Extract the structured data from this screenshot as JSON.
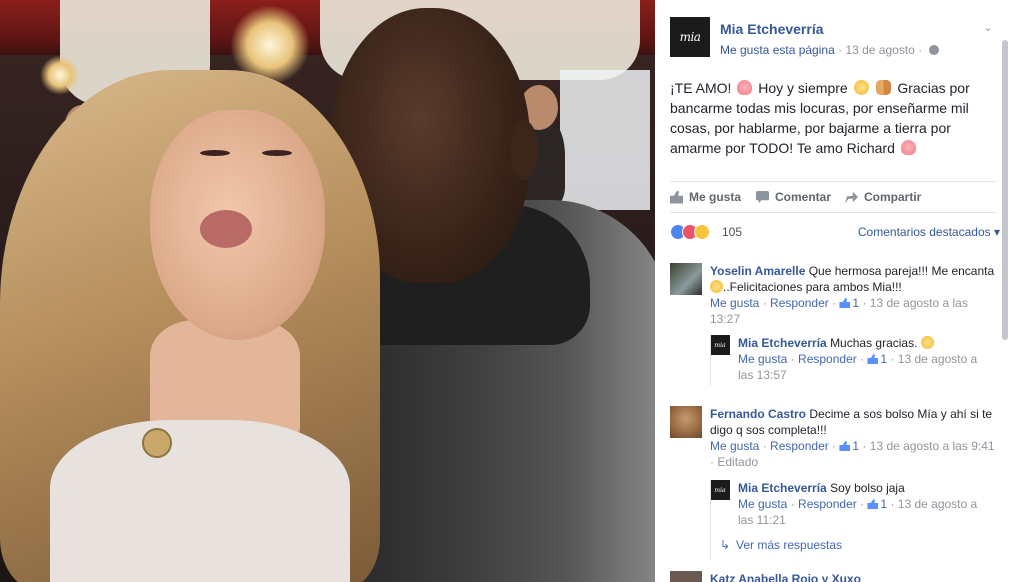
{
  "post": {
    "page_name": "Mia Etcheverría",
    "logo_text": "mia",
    "like_page": "Me gusta esta página",
    "date": "13 de agosto",
    "text_1": "¡TE AMO!",
    "text_2": "Hoy y siempre",
    "text_3": "Gracias por bancarme todas mis locuras, por enseñarme mil cosas, por hablarme, por bajarme a tierra por amarme por TODO! Te amo Richard",
    "icons": [
      "heart-emoji",
      "heart-eyes-emoji",
      "couple-emoji",
      "globe-icon",
      "chevron-down-icon"
    ]
  },
  "actions": {
    "like": "Me gusta",
    "comment": "Comentar",
    "share": "Compartir"
  },
  "reactions": {
    "count": "105",
    "sort_label": "Comentarios destacados",
    "types": [
      "like",
      "love",
      "wow"
    ],
    "colors": {
      "like": "#4e86f0",
      "love": "#f0506e",
      "wow": "#f7c53a"
    }
  },
  "comments": [
    {
      "name": "Yoselin Amarelle",
      "text_a": "Que hermosa pareja!!! Me encanta",
      "text_b": "..Felicitaciones para ambos Mia!!!",
      "like": "Me gusta",
      "reply": "Responder",
      "likes": "1",
      "time": "13 de agosto a las 13:27"
    },
    {
      "name": "Mia Etcheverría",
      "text": "Muchas gracias.",
      "like": "Me gusta",
      "reply": "Responder",
      "likes": "1",
      "time": "13 de agosto a las 13:57"
    },
    {
      "name": "Fernando Castro",
      "text": "Decime a sos bolso Mía y ahí si te digo q sos completa!!!",
      "like": "Me gusta",
      "reply": "Responder",
      "likes": "1",
      "time": "13 de agosto a las 9:41",
      "edited": "Editado"
    },
    {
      "name": "Mia Etcheverría",
      "text": "Soy bolso jaja",
      "like": "Me gusta",
      "reply": "Responder",
      "likes": "1",
      "time": "13 de agosto a las 11:21"
    }
  ],
  "more_replies": "Ver más respuestas",
  "partial_comment": "Katz Anabella Rojo y Xuxo",
  "colors": {
    "link": "#365899",
    "meta": "#90949c",
    "accent": "#4267b2"
  }
}
